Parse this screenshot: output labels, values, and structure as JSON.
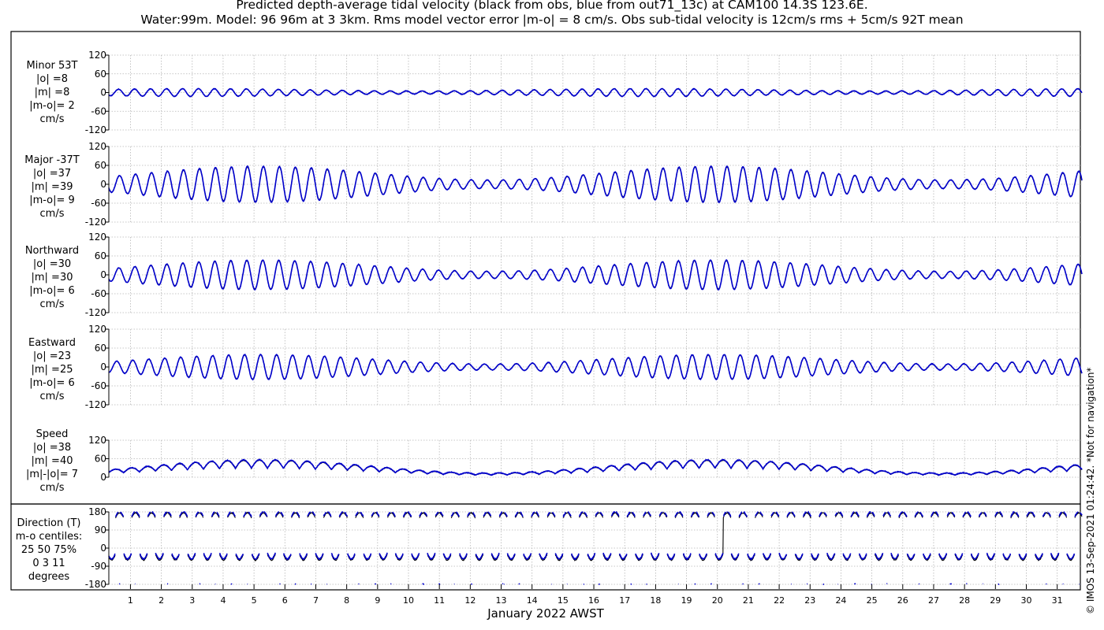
{
  "figure": {
    "title_line1": "Predicted depth-average tidal velocity (black from obs, blue from out71_13c) at CAM100 14.3S 123.6E.",
    "title_line2": "Water:99m. Model: 96 96m at 3 3km. Rms model vector error |m-o| = 8 cm/s. Obs sub-tidal velocity is 12cm/s rms + 5cm/s 92T mean",
    "xlabel": "January 2022 AWST",
    "copyright": "© IMOS 13-Sep-2021 01:24:42. *Not for navigation*",
    "colors": {
      "obs": "#000000",
      "model": "#0000cc",
      "grid": "#b5b5b5"
    }
  },
  "panels": [
    {
      "label_lines": [
        "Minor 53T",
        "|o| =8",
        "|m| =8",
        "|m-o|= 2",
        "cm/s"
      ]
    },
    {
      "label_lines": [
        "Major -37T",
        "|o| =37",
        "|m| =39",
        "|m-o|= 9",
        "cm/s"
      ]
    },
    {
      "label_lines": [
        "Northward",
        "|o| =30",
        "|m| =30",
        "|m-o|= 6",
        "cm/s"
      ]
    },
    {
      "label_lines": [
        "Eastward",
        "|o| =23",
        "|m| =25",
        "|m-o|= 6",
        "cm/s"
      ]
    },
    {
      "label_lines": [
        "Speed",
        "|o| =38",
        "|m| =40",
        "|m|-|o|= 7",
        "cm/s"
      ]
    },
    {
      "label_lines": [
        "Direction (T)",
        "m-o centiles:",
        "25  50  75%",
        "0   3  11",
        "degrees"
      ]
    }
  ],
  "chart_data": [
    {
      "type": "line",
      "title": "Minor 53T",
      "ylim": [
        -120,
        120
      ],
      "yticks": [
        "120",
        "60",
        "0",
        "-60",
        "-120"
      ],
      "yticks_values": [
        120,
        60,
        0,
        -60,
        -120
      ],
      "amplitude_cm_s": 12,
      "series": [
        {
          "name": "obs"
        },
        {
          "name": "model"
        }
      ]
    },
    {
      "type": "line",
      "title": "Major -37T",
      "ylim": [
        -120,
        120
      ],
      "yticks": [
        "120",
        "60",
        "0",
        "-60",
        "-120"
      ],
      "yticks_values": [
        120,
        60,
        0,
        -60,
        -120
      ],
      "amplitude_cm_s": 55,
      "series": [
        {
          "name": "obs"
        },
        {
          "name": "model"
        }
      ]
    },
    {
      "type": "line",
      "title": "Northward",
      "ylim": [
        -120,
        120
      ],
      "yticks": [
        "120",
        "60",
        "0",
        "-60",
        "-120"
      ],
      "yticks_values": [
        120,
        60,
        0,
        -60,
        -120
      ],
      "amplitude_cm_s": 45,
      "series": [
        {
          "name": "obs"
        },
        {
          "name": "model"
        }
      ]
    },
    {
      "type": "line",
      "title": "Eastward",
      "ylim": [
        -120,
        120
      ],
      "yticks": [
        "120",
        "60",
        "0",
        "-60",
        "-120"
      ],
      "yticks_values": [
        120,
        60,
        0,
        -60,
        -120
      ],
      "amplitude_cm_s": 38,
      "series": [
        {
          "name": "obs"
        },
        {
          "name": "model"
        }
      ]
    },
    {
      "type": "line",
      "title": "Speed",
      "ylim": [
        0,
        120
      ],
      "yticks": [
        "120",
        "60",
        "0"
      ],
      "yticks_values": [
        120,
        60,
        0
      ],
      "amplitude_cm_s": 55,
      "series": [
        {
          "name": "obs"
        },
        {
          "name": "model"
        }
      ]
    },
    {
      "type": "line",
      "title": "Direction (T)",
      "ylim": [
        -180,
        180
      ],
      "yticks": [
        "180",
        "90",
        "0",
        "-90",
        "-180"
      ],
      "yticks_values": [
        180,
        90,
        0,
        -90,
        -180
      ],
      "series": [
        {
          "name": "obs"
        },
        {
          "name": "model"
        }
      ]
    }
  ],
  "x_axis": {
    "day_start": 0.3,
    "day_end": 31.8,
    "tick_labels": [
      "1",
      "2",
      "3",
      "4",
      "5",
      "6",
      "7",
      "8",
      "9",
      "10",
      "11",
      "12",
      "13",
      "14",
      "15",
      "16",
      "17",
      "18",
      "19",
      "20",
      "21",
      "22",
      "23",
      "24",
      "25",
      "26",
      "27",
      "28",
      "29",
      "30",
      "31"
    ]
  }
}
